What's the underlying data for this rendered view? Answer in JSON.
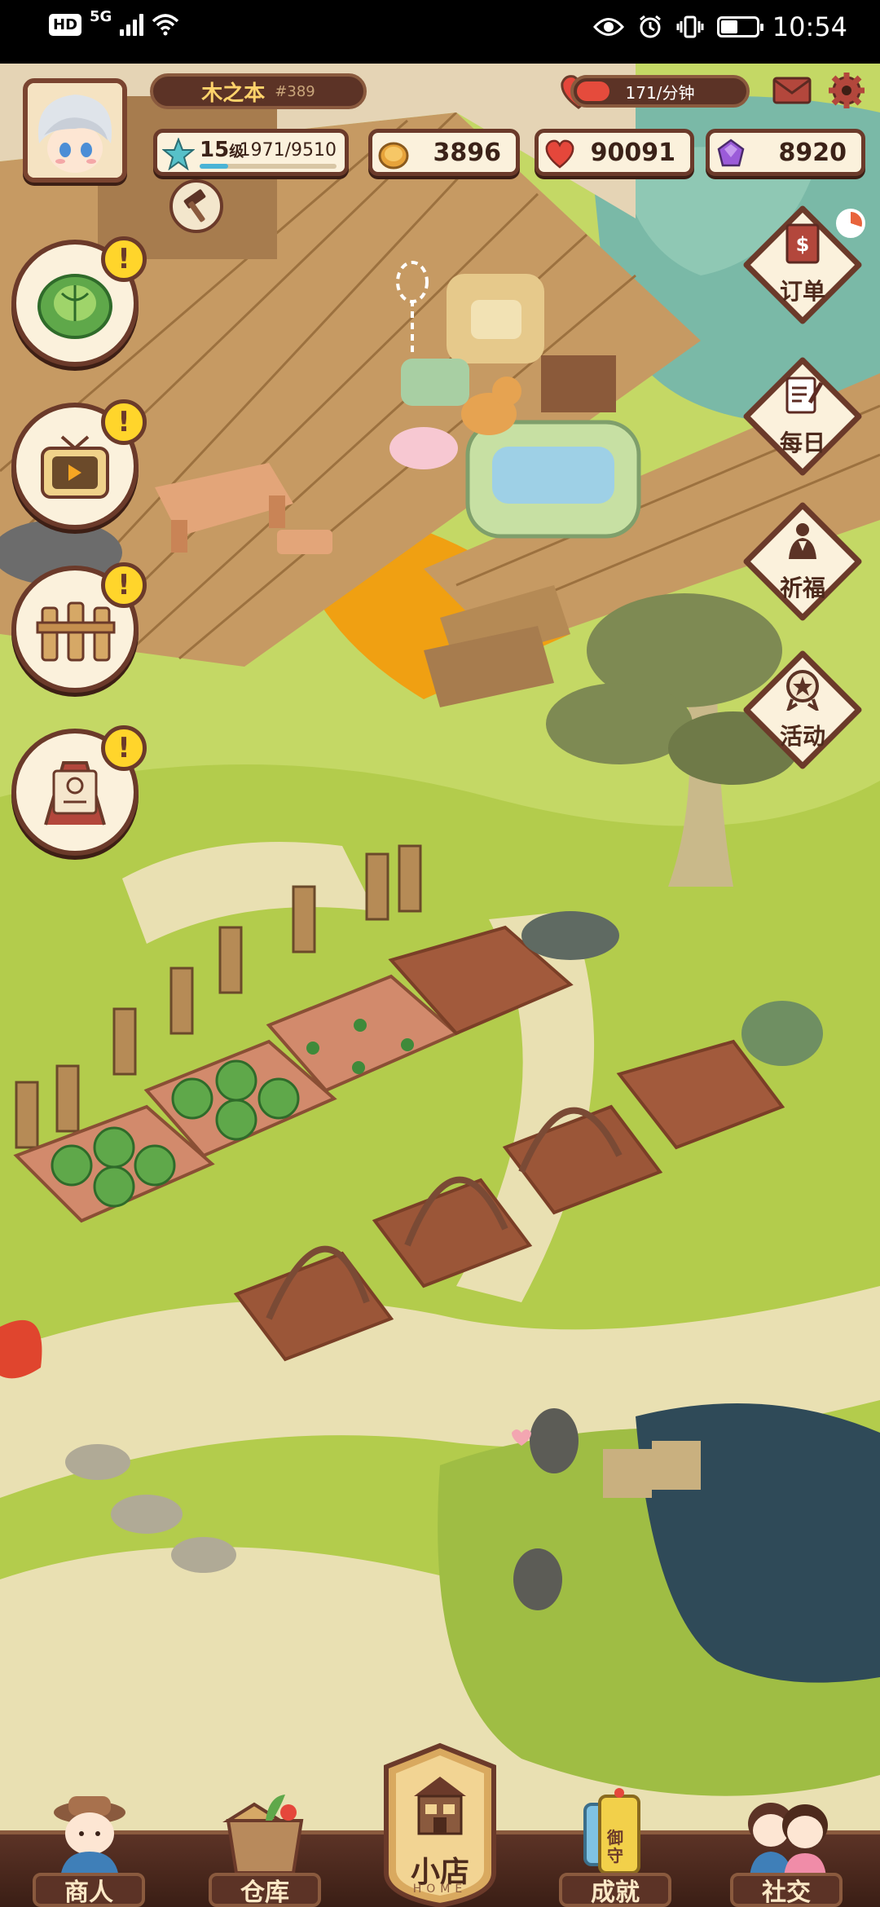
{
  "status_bar": {
    "hd": "HD",
    "network": "5G",
    "time": "10:54",
    "battery_level": 0.45
  },
  "hud": {
    "player_name": "木之本",
    "player_id": "#389",
    "energy_rate": "171/分钟",
    "level": "15",
    "level_unit": "级",
    "exp": "1971/9510",
    "exp_fraction": 0.21,
    "coins": "3896",
    "hearts": "90091",
    "gems": "8920"
  },
  "left_buttons": [
    {
      "icon": "cabbage-icon",
      "alert": "!"
    },
    {
      "icon": "tv-icon",
      "alert": "!"
    },
    {
      "icon": "fence-icon",
      "alert": "!"
    },
    {
      "icon": "signboard-icon",
      "alert": "!"
    }
  ],
  "right_buttons": [
    {
      "icon": "order-book-icon",
      "label": "订单"
    },
    {
      "icon": "daily-notebook-icon",
      "label": "每日"
    },
    {
      "icon": "praying-figure-icon",
      "label": "祈福"
    },
    {
      "icon": "event-badge-icon",
      "label": "活动"
    }
  ],
  "nav": {
    "merchant": "商人",
    "warehouse": "仓库",
    "home": "小店",
    "home_sub": "HOME",
    "achievement": "成就",
    "achievement_badge": "御守",
    "social": "社交"
  },
  "colors": {
    "wood_dark": "#6b3a2a",
    "panel_cream": "#fbf1dc",
    "grass": "#bcd45a",
    "alert_yellow": "#ffd52b"
  }
}
